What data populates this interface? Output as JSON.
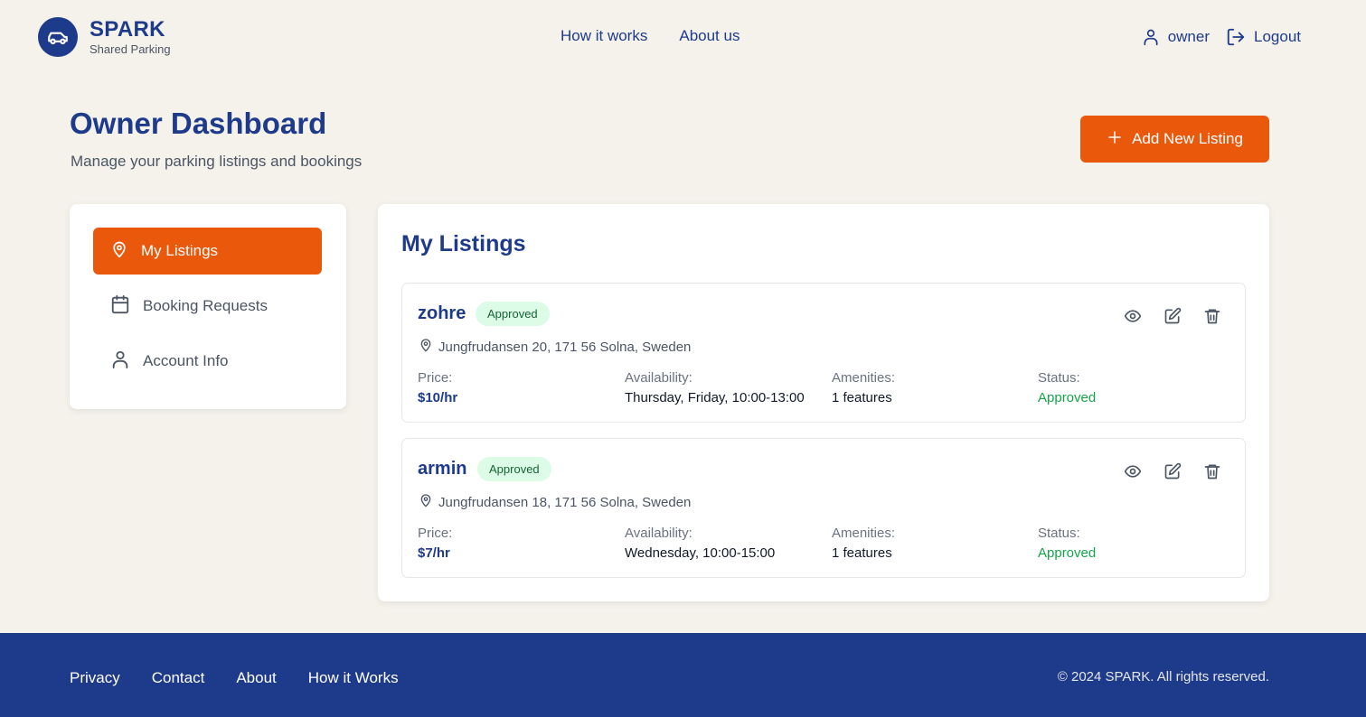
{
  "brand": {
    "title": "SPARK",
    "subtitle": "Shared Parking"
  },
  "nav": {
    "how_it_works": "How it works",
    "about_us": "About us"
  },
  "user": {
    "name": "owner",
    "logout": "Logout"
  },
  "page": {
    "title": "Owner Dashboard",
    "subtitle": "Manage your parking listings and bookings",
    "add_button": "Add New Listing"
  },
  "sidebar": {
    "items": [
      {
        "label": "My Listings",
        "icon": "map-pin-icon",
        "active": true
      },
      {
        "label": "Booking Requests",
        "icon": "calendar-icon",
        "active": false
      },
      {
        "label": "Account Info",
        "icon": "user-icon",
        "active": false
      }
    ]
  },
  "main": {
    "title": "My Listings",
    "labels": {
      "price": "Price:",
      "availability": "Availability:",
      "amenities": "Amenities:",
      "status": "Status:"
    },
    "listings": [
      {
        "name": "zohre",
        "badge": "Approved",
        "address": "Jungfrudansen 20, 171 56 Solna, Sweden",
        "price": "$10/hr",
        "availability": "Thursday, Friday, 10:00-13:00",
        "amenities": "1 features",
        "status": "Approved"
      },
      {
        "name": "armin",
        "badge": "Approved",
        "address": "Jungfrudansen 18, 171 56 Solna, Sweden",
        "price": "$7/hr",
        "availability": "Wednesday, 10:00-15:00",
        "amenities": "1 features",
        "status": "Approved"
      }
    ]
  },
  "footer": {
    "links": [
      "Privacy",
      "Contact",
      "About",
      "How it Works"
    ],
    "copyright": "© 2024 SPARK. All rights reserved."
  },
  "colors": {
    "primary": "#1e3a8a",
    "accent": "#ea580c",
    "background": "#f5f2ec",
    "success": "#16a34a"
  }
}
